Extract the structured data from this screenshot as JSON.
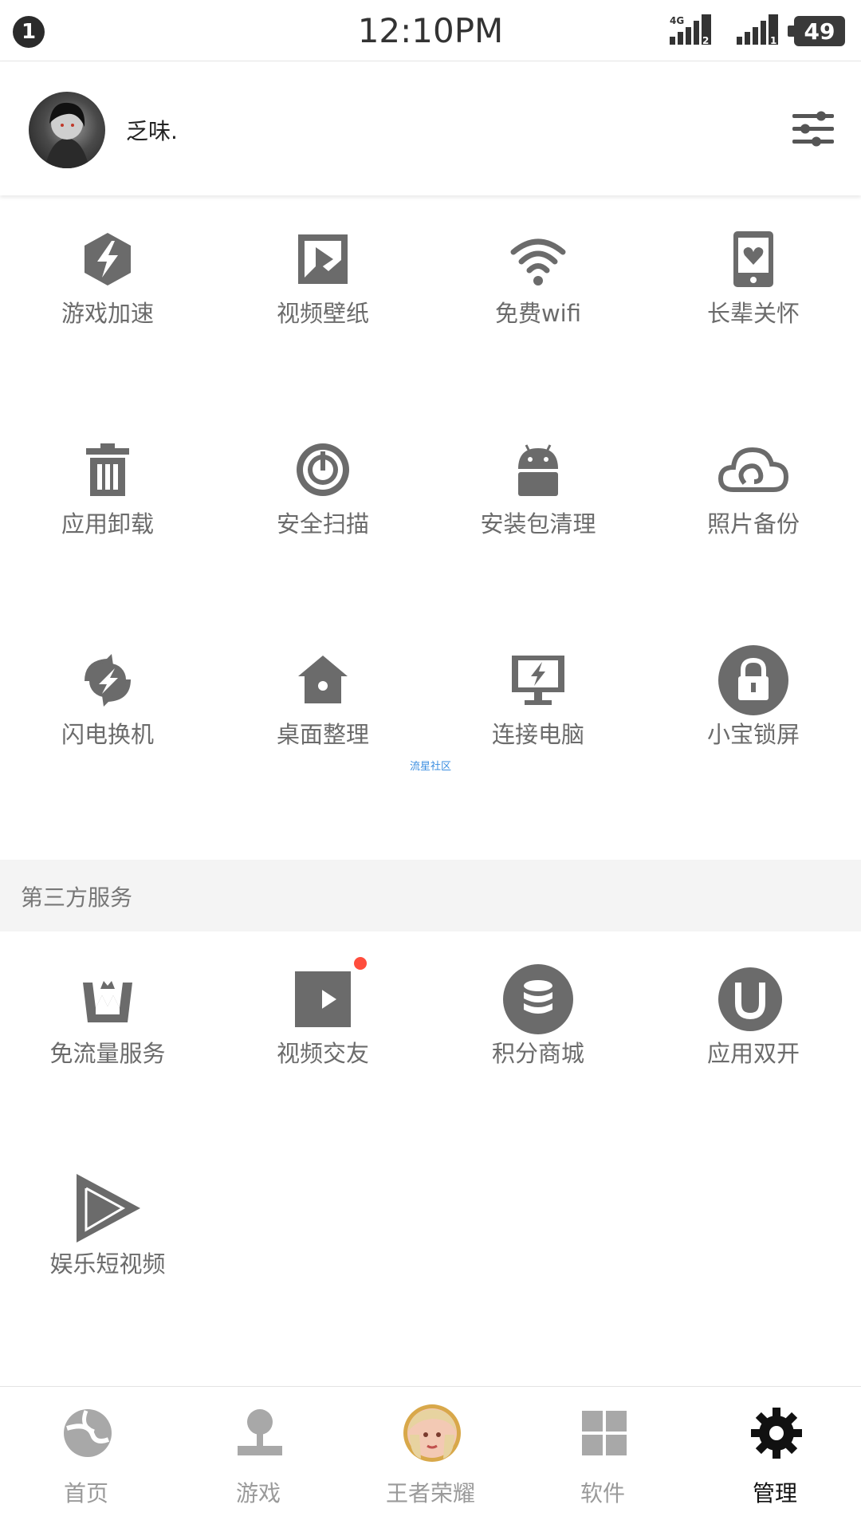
{
  "status_bar": {
    "notification_count": "1",
    "time": "12:10PM",
    "network_type": "4G",
    "sim1": "2",
    "sim2": "1",
    "battery": "49"
  },
  "profile": {
    "username": "乏味."
  },
  "tools": [
    {
      "label": "游戏加速",
      "icon": "game-boost-icon"
    },
    {
      "label": "视频壁纸",
      "icon": "video-wallpaper-icon"
    },
    {
      "label": "免费wifi",
      "icon": "wifi-icon"
    },
    {
      "label": "长辈关怀",
      "icon": "elder-care-icon"
    },
    {
      "label": "应用卸载",
      "icon": "trash-icon"
    },
    {
      "label": "安全扫描",
      "icon": "security-scan-icon"
    },
    {
      "label": "安装包清理",
      "icon": "android-icon"
    },
    {
      "label": "照片备份",
      "icon": "cloud-icon"
    },
    {
      "label": "闪电换机",
      "icon": "flash-transfer-icon"
    },
    {
      "label": "桌面整理",
      "icon": "home-icon"
    },
    {
      "label": "连接电脑",
      "icon": "monitor-icon"
    },
    {
      "label": "小宝锁屏",
      "icon": "lock-icon"
    }
  ],
  "watermark": "流星社区",
  "third_party": {
    "title": "第三方服务",
    "items": [
      {
        "label": "免流量服务",
        "icon": "crown-w-icon"
      },
      {
        "label": "视频交友",
        "icon": "video-chat-icon",
        "badge": true
      },
      {
        "label": "积分商城",
        "icon": "coins-icon"
      },
      {
        "label": "应用双开",
        "icon": "magnet-icon"
      },
      {
        "label": "娱乐短视频",
        "icon": "play-icon"
      }
    ]
  },
  "bottom_nav": [
    {
      "label": "首页",
      "icon": "home-logo-icon",
      "active": false
    },
    {
      "label": "游戏",
      "icon": "joystick-icon",
      "active": false
    },
    {
      "label": "王者荣耀",
      "icon": "game-avatar-icon",
      "active": false
    },
    {
      "label": "软件",
      "icon": "apps-grid-icon",
      "active": false
    },
    {
      "label": "管理",
      "icon": "gear-icon",
      "active": true
    }
  ],
  "colors": {
    "icon_gray": "#6b6b6b",
    "badge_red": "#ff4d3d",
    "section_bg": "#f4f4f4",
    "active_nav": "#111111"
  }
}
